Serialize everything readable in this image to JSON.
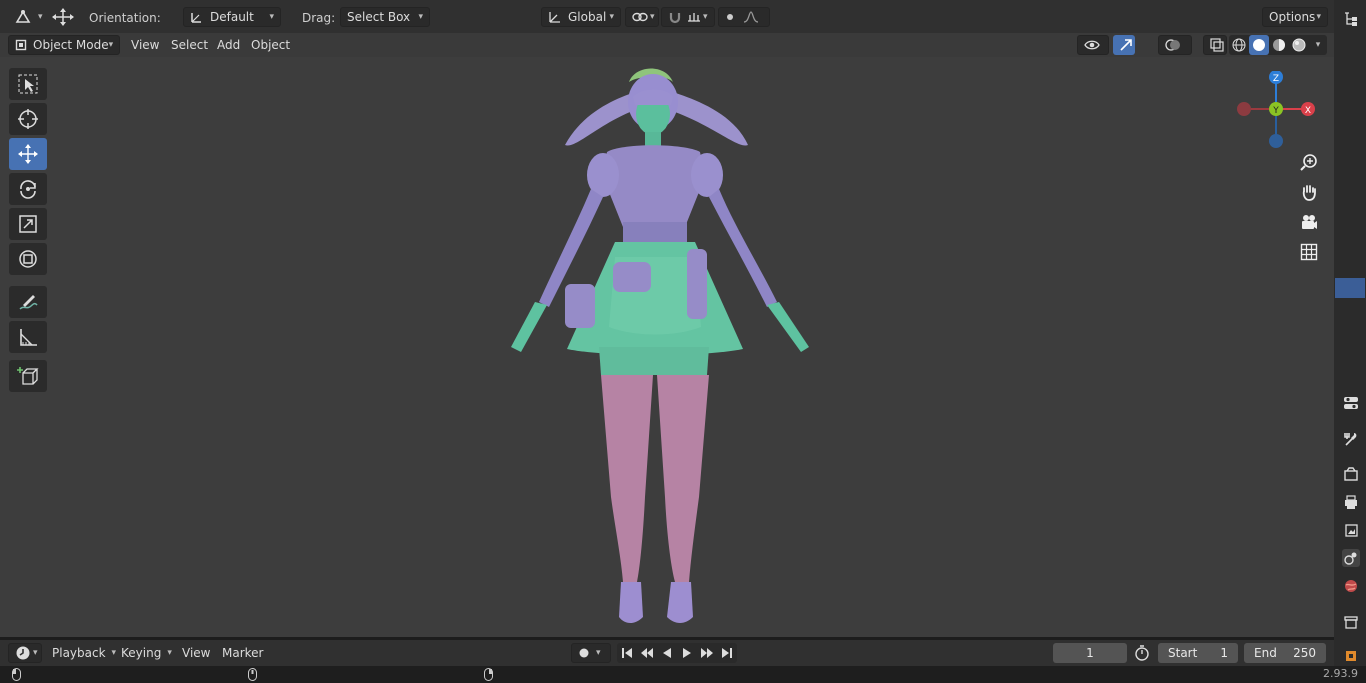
{
  "topbar": {
    "orientation_label": "Orientation:",
    "orientation_value": "Default",
    "drag_label": "Drag:",
    "drag_value": "Select Box",
    "transform_space": "Global",
    "options_label": "Options"
  },
  "header": {
    "mode": "Object Mode",
    "menus": [
      "View",
      "Select",
      "Add",
      "Object"
    ]
  },
  "gizmo": {
    "x": "X",
    "y": "Y",
    "z": "Z"
  },
  "timeline": {
    "menus": [
      "Playback",
      "Keying",
      "View",
      "Marker"
    ],
    "current_frame": "1",
    "start_label": "Start",
    "start_value": "1",
    "end_label": "End",
    "end_value": "250"
  },
  "status": {
    "version": "2.93.9"
  },
  "colors": {
    "accent": "#4772b3",
    "axis_x": "#d9404a",
    "axis_y": "#8bc424",
    "axis_z": "#2d7ed8",
    "viewport_bg": "#3d3d3d"
  }
}
